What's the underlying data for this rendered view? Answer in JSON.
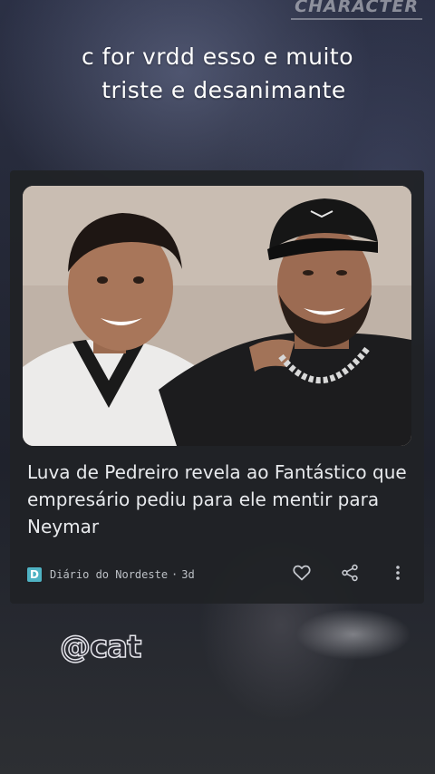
{
  "watermark": {
    "brand": "CHARACTER",
    "handle": "@cat"
  },
  "caption": {
    "line1": "c for vrdd esso e muito",
    "line2": "triste e desanimante"
  },
  "news_card": {
    "headline": "Luva de Pedreiro revela ao Fantástico que empresário pediu para ele mentir para Neymar",
    "source_initial": "D",
    "source_name": "Diário do Nordeste",
    "separator": "·",
    "age": "3d",
    "source_color": "#4fb3c4",
    "actions": [
      "heart-icon",
      "share-icon",
      "more-vertical-icon"
    ]
  },
  "colors": {
    "card_background": "#202226",
    "headline_text": "#e8eaed",
    "meta_text": "#bdc1c6"
  }
}
